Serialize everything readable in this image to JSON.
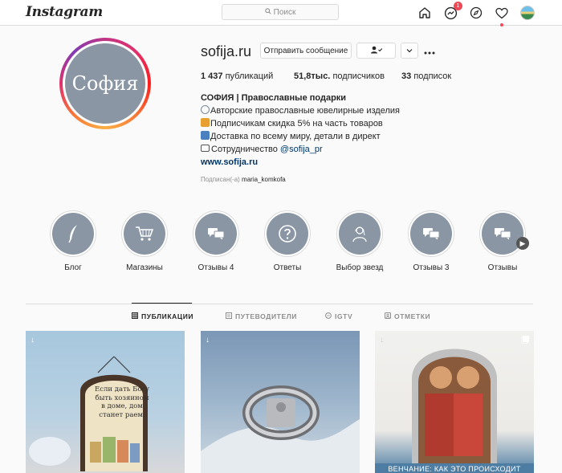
{
  "header": {
    "logo": "Instagram",
    "search_placeholder": "Поиск",
    "dm_badge": "1"
  },
  "profile": {
    "avatar_text": "София",
    "username": "sofija.ru",
    "message_button": "Отправить сообщение",
    "stats": {
      "posts_count": "1 437",
      "posts_label": "публикаций",
      "followers_count": "51,8тыс.",
      "followers_label": "подписчиков",
      "following_count": "33",
      "following_label": "подписок"
    },
    "bio": {
      "name": "СОФИЯ | Православные подарки",
      "line1": "Авторские православные ювелирные изделия",
      "line2": "Подписчикам скидка 5% на часть товаров",
      "line3": "Доставка по всему миру, детали в директ",
      "line4_text": "Сотрудничество",
      "line4_mention": "@sofija_pr",
      "website": "www.sofija.ru"
    },
    "followed_by_label": "Подписан(-а)",
    "followed_by_user": "maria_komkofa"
  },
  "highlights": [
    {
      "label": "Блог",
      "icon": "feather-icon"
    },
    {
      "label": "Магазины",
      "icon": "cart-icon"
    },
    {
      "label": "Отзывы 4",
      "icon": "chat-bubbles-icon"
    },
    {
      "label": "Ответы",
      "icon": "question-icon"
    },
    {
      "label": "Выбор звезд",
      "icon": "person-icon"
    },
    {
      "label": "Отзывы 3",
      "icon": "chat-bubbles-icon"
    },
    {
      "label": "Отзывы",
      "icon": "chat-bubbles-icon"
    }
  ],
  "tabs": {
    "posts": "ПУБЛИКАЦИИ",
    "guides": "ПУТЕВОДИТЕЛИ",
    "igtv": "IGTV",
    "tagged": "ОТМЕТКИ"
  },
  "posts": [
    {
      "caption": "Если дать Богу быть хозяином в доме, дом станет раем."
    },
    {
      "caption": ""
    },
    {
      "caption": "ВЕНЧАНИЕ: КАК ЭТО ПРОИСХОДИТ"
    }
  ]
}
